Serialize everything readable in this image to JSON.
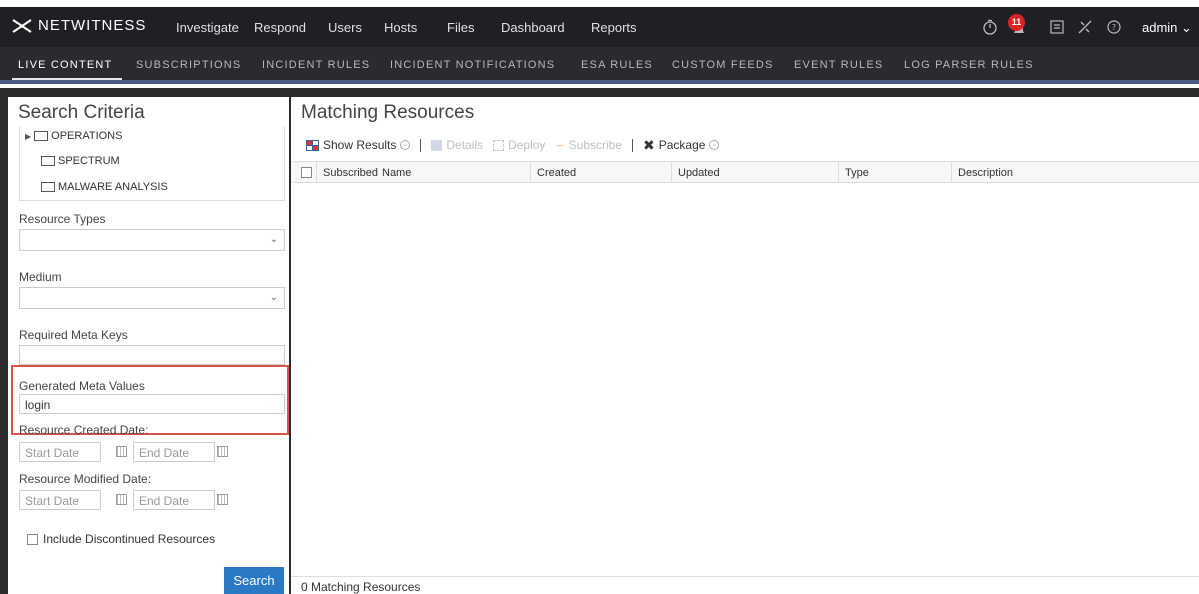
{
  "app": {
    "brand": "NETWITNESS",
    "nav": [
      "Investigate",
      "Respond",
      "Users",
      "Hosts",
      "Files",
      "Dashboard",
      "Reports"
    ],
    "notification_count": "11",
    "user": "admin"
  },
  "subnav": {
    "items": [
      "LIVE CONTENT",
      "SUBSCRIPTIONS",
      "INCIDENT RULES",
      "INCIDENT NOTIFICATIONS",
      "ESA RULES",
      "CUSTOM FEEDS",
      "EVENT RULES",
      "LOG PARSER RULES"
    ],
    "active": "LIVE CONTENT"
  },
  "search": {
    "title": "Search Criteria",
    "tree": [
      "OPERATIONS",
      "SPECTRUM",
      "MALWARE ANALYSIS"
    ],
    "resource_types_label": "Resource Types",
    "resource_types_value": "",
    "medium_label": "Medium",
    "medium_value": "",
    "required_meta_keys_label": "Required Meta Keys",
    "required_meta_keys_value": "",
    "generated_meta_values_label": "Generated Meta Values",
    "generated_meta_values_value": "login",
    "created_date_label": "Resource Created Date:",
    "modified_date_label": "Resource Modified Date:",
    "start_date_placeholder": "Start Date",
    "end_date_placeholder": "End Date",
    "include_discontinued_label": "Include Discontinued Resources",
    "search_button": "Search"
  },
  "results": {
    "title": "Matching Resources",
    "toolbar": {
      "show_results": "Show Results",
      "details": "Details",
      "deploy": "Deploy",
      "subscribe": "Subscribe",
      "package": "Package"
    },
    "columns": [
      "Subscribed",
      "Name",
      "Created",
      "Updated",
      "Type",
      "Description"
    ],
    "footer": "0 Matching Resources"
  },
  "colors": {
    "topbar": "#1f2023",
    "subbar": "#2a2b2f",
    "accent_blue": "#2b78c4",
    "highlight_red": "#d9534f",
    "badge_red": "#d22"
  }
}
